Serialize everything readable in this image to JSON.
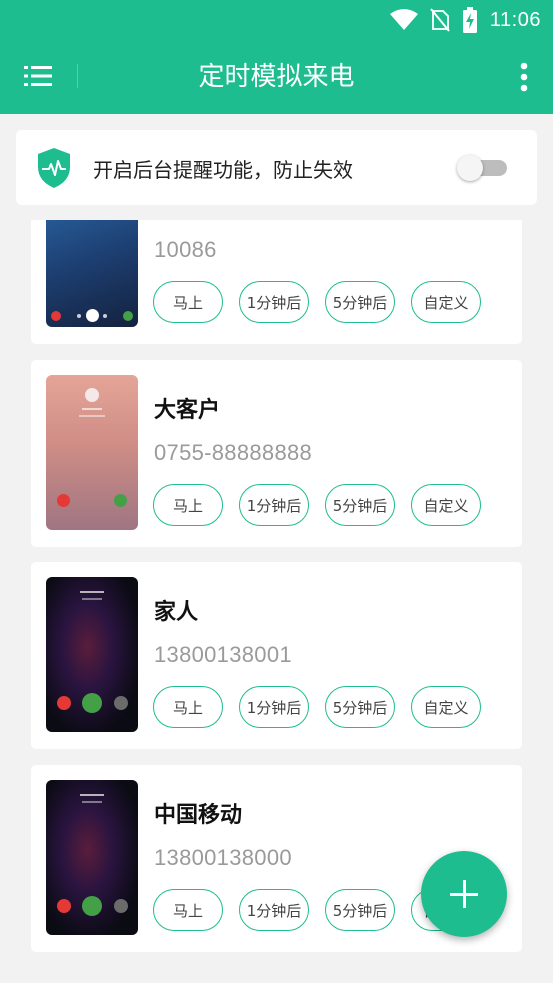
{
  "status_bar": {
    "time": "11:06",
    "icons": [
      "wifi-icon",
      "no-sim-icon",
      "battery-charging-icon"
    ]
  },
  "app_bar": {
    "title": "定时模拟来电",
    "menu_icon": "list-menu-icon",
    "more_icon": "more-vert-icon"
  },
  "background_reminder": {
    "label": "开启后台提醒功能，防止失效",
    "icon": "shield-pulse-icon",
    "enabled": false
  },
  "contacts": [
    {
      "name": "",
      "number": "10086",
      "screen": "blue",
      "buttons": [
        "马上",
        "1分钟后",
        "5分钟后",
        "自定义"
      ]
    },
    {
      "name": "大客户",
      "number": "0755-88888888",
      "screen": "pink",
      "buttons": [
        "马上",
        "1分钟后",
        "5分钟后",
        "自定义"
      ]
    },
    {
      "name": "家人",
      "number": "13800138001",
      "screen": "dark",
      "buttons": [
        "马上",
        "1分钟后",
        "5分钟后",
        "自定义"
      ]
    },
    {
      "name": "中国移动",
      "number": "13800138000",
      "screen": "dark",
      "buttons": [
        "马上",
        "1分钟后",
        "5分钟后",
        "自定义"
      ]
    }
  ],
  "fab": {
    "icon": "plus-icon"
  },
  "colors": {
    "accent": "#1ebd8f",
    "background": "#f2f2f2",
    "number_gray": "#9a9a9a"
  }
}
